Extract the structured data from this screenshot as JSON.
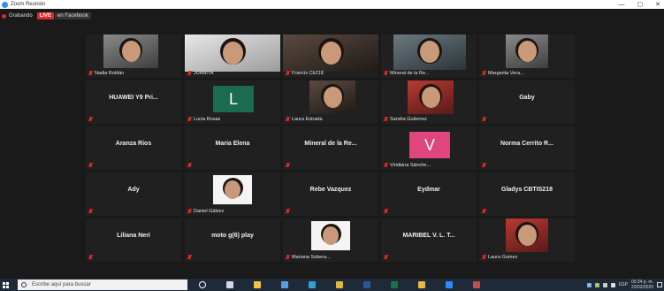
{
  "window": {
    "title": "Zoom Reunión",
    "controls": [
      "—",
      "▢",
      "✕"
    ]
  },
  "recording": {
    "status_text": "Grabando",
    "live_badge": "LIVE",
    "live_destination": "en Facebook"
  },
  "participants": [
    {
      "name": "Nadia Roldán",
      "label": "Nadia Roldán",
      "muted": true,
      "video": "gray"
    },
    {
      "name": "JUANITA",
      "label": "JUANITA",
      "muted": true,
      "video": "light"
    },
    {
      "name": "Francis Cb218",
      "label": "Francis Cb218",
      "muted": true,
      "video": "dark"
    },
    {
      "name": "Mineral de la Re...",
      "label": "Mineral de la Re...",
      "muted": true,
      "video": "car"
    },
    {
      "name": "Margarita Vera...",
      "label": "Margarita Vera...",
      "muted": true,
      "video": "gray"
    },
    {
      "name": "HUAWEI Y9 Pri...",
      "label": "",
      "muted": true,
      "video": "none"
    },
    {
      "name": "Lucia Rosas",
      "label": "Lucia Rosas",
      "muted": true,
      "video": "avatar",
      "avatar_letter": "L",
      "avatar_color": "#1a6b4f"
    },
    {
      "name": "Laura Estrada",
      "label": "Laura Estrada",
      "muted": true,
      "video": "dark"
    },
    {
      "name": "Sandra Gutierrez",
      "label": "Sandra Gutierrez",
      "muted": true,
      "video": "red"
    },
    {
      "name": "Gaby",
      "label": "",
      "muted": true,
      "video": "none"
    },
    {
      "name": "Aranza Rios",
      "label": "",
      "muted": true,
      "video": "none"
    },
    {
      "name": "Maria Elena",
      "label": "",
      "muted": true,
      "video": "none"
    },
    {
      "name": "Mineral de la Re...",
      "label": "",
      "muted": true,
      "video": "none"
    },
    {
      "name": "Viridiana Sánche...",
      "label": "Viridiana Sánche...",
      "muted": true,
      "video": "avatar",
      "avatar_letter": "V",
      "avatar_color": "#e0457b"
    },
    {
      "name": "Norma Cerrito R...",
      "label": "",
      "muted": true,
      "video": "none"
    },
    {
      "name": "Ady",
      "label": "",
      "muted": true,
      "video": "none"
    },
    {
      "name": "Daniel Gálvez",
      "label": "Daniel Gálvez",
      "muted": true,
      "video": "white"
    },
    {
      "name": "Rebe Vazquez",
      "label": "",
      "muted": true,
      "video": "none"
    },
    {
      "name": "Eydmar",
      "label": "",
      "muted": true,
      "video": "none"
    },
    {
      "name": "Gladys CBTIS218",
      "label": "",
      "muted": true,
      "video": "none"
    },
    {
      "name": "Liliana Neri",
      "label": "",
      "muted": true,
      "video": "none"
    },
    {
      "name": "moto g(6) play",
      "label": "",
      "muted": true,
      "video": "none"
    },
    {
      "name": "Mariana Sobera...",
      "label": "Mariana Sobera...",
      "muted": true,
      "video": "white"
    },
    {
      "name": "MARIBEL V. L. T...",
      "label": "",
      "muted": true,
      "video": "none"
    },
    {
      "name": "Laura Gomez",
      "label": "Laura Gomez",
      "muted": true,
      "video": "red"
    }
  ],
  "taskbar": {
    "search_placeholder": "Escribe aquí para buscar",
    "apps": [
      {
        "name": "cortana-icon",
        "color": "#ffffff"
      },
      {
        "name": "task-view-icon",
        "color": "#cfd8e3"
      },
      {
        "name": "file-explorer-icon",
        "color": "#f2c14e"
      },
      {
        "name": "store-icon",
        "color": "#5aa0e0"
      },
      {
        "name": "edge-icon",
        "color": "#2d9fd9"
      },
      {
        "name": "chrome-icon",
        "color": "#e0b83a"
      },
      {
        "name": "word-icon",
        "color": "#2b5797"
      },
      {
        "name": "excel-icon",
        "color": "#1e7145"
      },
      {
        "name": "folder-icon",
        "color": "#e8b84b"
      },
      {
        "name": "zoom-icon",
        "color": "#2d8cff"
      },
      {
        "name": "app-icon",
        "color": "#c94a4a"
      }
    ],
    "language": "ESP",
    "time": "05:34 p. m.",
    "date": "22/02/2020"
  }
}
